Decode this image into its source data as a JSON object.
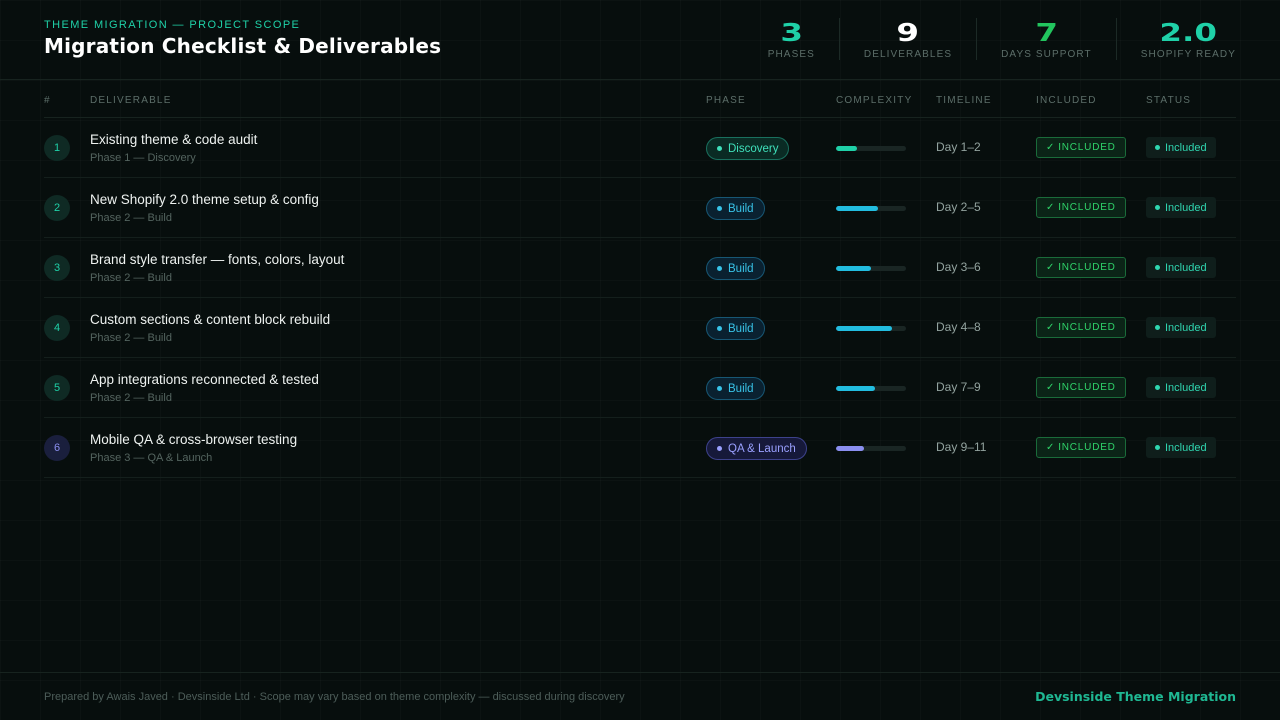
{
  "header": {
    "eyebrow": "THEME MIGRATION — PROJECT SCOPE",
    "title": "Migration Checklist & Deliverables",
    "stats": [
      {
        "value": "3",
        "label": "PHASES"
      },
      {
        "value": "9",
        "label": "DELIVERABLES"
      },
      {
        "value": "7",
        "label": "DAYS SUPPORT"
      },
      {
        "value": "2.0",
        "label": "SHOPIFY READY"
      }
    ]
  },
  "table": {
    "columns": [
      "#",
      "DELIVERABLE",
      "PHASE",
      "COMPLEXITY",
      "TIMELINE",
      "INCLUDED",
      "STATUS"
    ],
    "rows": [
      {
        "num": "1",
        "title": "Existing theme & code audit",
        "subtitle": "Phase 1 — Discovery",
        "phase": "Discovery",
        "complexity": 0.3,
        "timeline": "Day 1–2",
        "included": "INCLUDED",
        "status": "Included"
      },
      {
        "num": "2",
        "title": "New Shopify 2.0 theme setup & config",
        "subtitle": "Phase 2 — Build",
        "phase": "Build",
        "complexity": 0.6,
        "timeline": "Day 2–5",
        "included": "INCLUDED",
        "status": "Included"
      },
      {
        "num": "3",
        "title": "Brand style transfer — fonts, colors, layout",
        "subtitle": "Phase 2 — Build",
        "phase": "Build",
        "complexity": 0.5,
        "timeline": "Day 3–6",
        "included": "INCLUDED",
        "status": "Included"
      },
      {
        "num": "4",
        "title": "Custom sections & content block rebuild",
        "subtitle": "Phase 2 — Build",
        "phase": "Build",
        "complexity": 0.8,
        "timeline": "Day 4–8",
        "included": "INCLUDED",
        "status": "Included"
      },
      {
        "num": "5",
        "title": "App integrations reconnected & tested",
        "subtitle": "Phase 2 — Build",
        "phase": "Build",
        "complexity": 0.55,
        "timeline": "Day 7–9",
        "included": "INCLUDED",
        "status": "Included"
      },
      {
        "num": "6",
        "title": "Mobile QA & cross-browser testing",
        "subtitle": "Phase 3 — QA & Launch",
        "phase": "QA & Launch",
        "complexity": 0.4,
        "timeline": "Day 9–11",
        "included": "INCLUDED",
        "status": "Included"
      }
    ]
  },
  "footer": {
    "note": "Prepared by Awais Javed · Devsinside Ltd · Scope may vary based on theme complexity — discussed during discovery",
    "brand": "Devsinside Theme Migration"
  },
  "colors": {
    "accent": "#1fd1a8",
    "build": "#38c3e8",
    "qa": "#9aa0ff",
    "included": "#2fd46a",
    "background": "#070e0d"
  }
}
